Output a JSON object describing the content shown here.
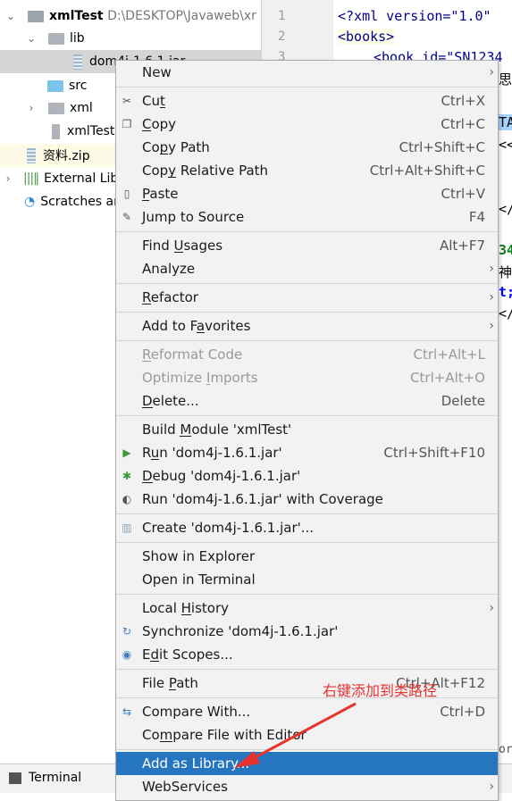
{
  "project_tree": {
    "root": {
      "name": "xmlTest",
      "path": "D:\\DESKTOP\\Javaweb\\xr"
    },
    "items": [
      {
        "label": "lib",
        "type": "folder",
        "expanded": true
      },
      {
        "label": "dom4j-1.6.1.jar",
        "type": "jar",
        "selected": true
      },
      {
        "label": "src",
        "type": "source-folder"
      },
      {
        "label": "xml",
        "type": "folder",
        "expanded": false
      },
      {
        "label": "xmlTest.iml",
        "type": "module-file"
      },
      {
        "label": "资料.zip",
        "type": "zip"
      },
      {
        "label": "External Libraries",
        "type": "libraries"
      },
      {
        "label": "Scratches and Consoles",
        "type": "scratches"
      }
    ]
  },
  "editor": {
    "line_numbers": [
      "1",
      "2",
      "3"
    ],
    "lines": [
      "<?xml version=\"1.0\"",
      "<books>",
      "<book id=\"SN1234"
    ],
    "fragments": [
      "思",
      "TA",
      "<<",
      "</",
      "34",
      "神",
      "t;",
      "</",
      "or"
    ]
  },
  "bottom_bar": {
    "terminal_label": "Terminal"
  },
  "context_menu": {
    "accent": "#2675bf",
    "items": [
      {
        "label": "New",
        "mn": -1,
        "submenu": true
      },
      {
        "sep": true
      },
      {
        "label": "Cut",
        "mn": 2,
        "shortcut": "Ctrl+X",
        "icon": "scissors-icon",
        "glyph": "✂"
      },
      {
        "label": "Copy",
        "mn": 0,
        "shortcut": "Ctrl+C",
        "icon": "copy-icon",
        "glyph": "❐"
      },
      {
        "label": "Copy Path",
        "mn": 2,
        "shortcut": "Ctrl+Shift+C"
      },
      {
        "label": "Copy Relative Path",
        "mn": 3,
        "shortcut": "Ctrl+Alt+Shift+C"
      },
      {
        "label": "Paste",
        "mn": 0,
        "shortcut": "Ctrl+V",
        "icon": "clipboard-icon",
        "glyph": "▯"
      },
      {
        "label": "Jump to Source",
        "mn": -1,
        "shortcut": "F4",
        "icon": "pencil-icon",
        "glyph": "✎"
      },
      {
        "sep": true
      },
      {
        "label": "Find Usages",
        "mn": 5,
        "shortcut": "Alt+F7"
      },
      {
        "label": "Analyze",
        "mn": -1,
        "submenu": true
      },
      {
        "sep": true
      },
      {
        "label": "Refactor",
        "mn": 0,
        "submenu": true
      },
      {
        "sep": true
      },
      {
        "label": "Add to Favorites",
        "mn": 8,
        "submenu": true
      },
      {
        "sep": true
      },
      {
        "label": "Reformat Code",
        "mn": 0,
        "shortcut": "Ctrl+Alt+L",
        "disabled": true
      },
      {
        "label": "Optimize Imports",
        "mn": 9,
        "shortcut": "Ctrl+Alt+O",
        "disabled": true
      },
      {
        "label": "Delete...",
        "mn": 0,
        "shortcut": "Delete"
      },
      {
        "sep": true
      },
      {
        "label": "Build Module 'xmlTest'",
        "mn": 6
      },
      {
        "label": "Run 'dom4j-1.6.1.jar'",
        "mn": 1,
        "shortcut": "Ctrl+Shift+F10",
        "icon": "run-icon",
        "glyph": "▶",
        "color": "#3c9a3c"
      },
      {
        "label": "Debug 'dom4j-1.6.1.jar'",
        "mn": 0,
        "icon": "debug-icon",
        "glyph": "✱",
        "color": "#3c9a3c"
      },
      {
        "label": "Run 'dom4j-1.6.1.jar' with Coverage",
        "mn": 35,
        "icon": "coverage-icon",
        "glyph": "◐",
        "color": "#555"
      },
      {
        "sep": true
      },
      {
        "label": "Create 'dom4j-1.6.1.jar'...",
        "mn": -1,
        "icon": "jar-icon",
        "glyph": "▥",
        "color": "#8aa6bf"
      },
      {
        "sep": true
      },
      {
        "label": "Show in Explorer",
        "mn": -1
      },
      {
        "label": "Open in Terminal",
        "mn": -1
      },
      {
        "sep": true
      },
      {
        "label": "Local History",
        "mn": 6,
        "submenu": true
      },
      {
        "label": "Synchronize 'dom4j-1.6.1.jar'",
        "mn": -1,
        "icon": "sync-icon",
        "glyph": "↻",
        "color": "#3d7fc1"
      },
      {
        "label": "Edit Scopes...",
        "mn": 1,
        "icon": "scope-icon",
        "glyph": "◉",
        "color": "#3d7fc1"
      },
      {
        "sep": true
      },
      {
        "label": "File Path",
        "mn": 5,
        "shortcut": "Ctrl+Alt+F12"
      },
      {
        "sep": true
      },
      {
        "label": "Compare With...",
        "mn": -1,
        "shortcut": "Ctrl+D",
        "icon": "compare-icon",
        "glyph": "⇆",
        "color": "#3d7fc1"
      },
      {
        "label": "Compare File with Editor",
        "mn": 2
      },
      {
        "sep": true
      },
      {
        "label": "Add as Library...",
        "mn": -1,
        "selected": true
      },
      {
        "label": "WebServices",
        "mn": -1,
        "submenu": true
      }
    ]
  },
  "annotation": {
    "text": "右键添加到类路径",
    "color": "#e8322e"
  }
}
